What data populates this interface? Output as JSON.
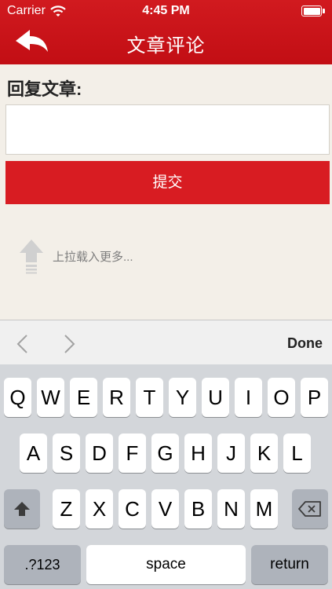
{
  "status_bar": {
    "carrier": "Carrier",
    "time": "4:45 PM"
  },
  "nav": {
    "title": "文章评论",
    "back_icon": "back-arrow-icon"
  },
  "content": {
    "reply_label": "回复文章:",
    "input_value": "",
    "input_placeholder": "",
    "submit_label": "提交",
    "pull_hint": "上拉载入更多..."
  },
  "accessory": {
    "done_label": "Done"
  },
  "keyboard": {
    "row1": [
      "Q",
      "W",
      "E",
      "R",
      "T",
      "Y",
      "U",
      "I",
      "O",
      "P"
    ],
    "row2": [
      "A",
      "S",
      "D",
      "F",
      "G",
      "H",
      "J",
      "K",
      "L"
    ],
    "row3": [
      "Z",
      "X",
      "C",
      "V",
      "B",
      "N",
      "M"
    ],
    "numbers_label": ".?123",
    "space_label": "space",
    "return_label": "return"
  },
  "colors": {
    "brand_red": "#c8141a",
    "button_red": "#d81c22",
    "background": "#f3efe8"
  }
}
